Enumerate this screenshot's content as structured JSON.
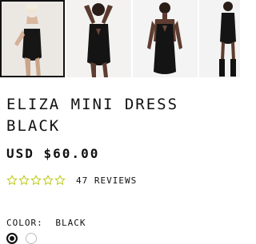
{
  "gallery": {
    "images": [
      {
        "name": "product-photo-1",
        "bg": "#e9e5e1",
        "selected": true
      },
      {
        "name": "product-photo-2",
        "bg": "#f3f2f1",
        "selected": false
      },
      {
        "name": "product-photo-3",
        "bg": "#f4f4f4",
        "selected": false
      },
      {
        "name": "product-photo-4",
        "bg": "#f3f3f3",
        "selected": false
      }
    ]
  },
  "product": {
    "title_line1": "ELIZA MINI DRESS",
    "title_line2": "BLACK",
    "price": "USD $60.00"
  },
  "rating": {
    "stars": 0,
    "max_stars": 5,
    "star_color": "#b7c400",
    "reviews_label": "47 REVIEWS"
  },
  "color": {
    "label": "COLOR:",
    "selected": "BLACK",
    "swatches": [
      "black",
      "white"
    ]
  }
}
